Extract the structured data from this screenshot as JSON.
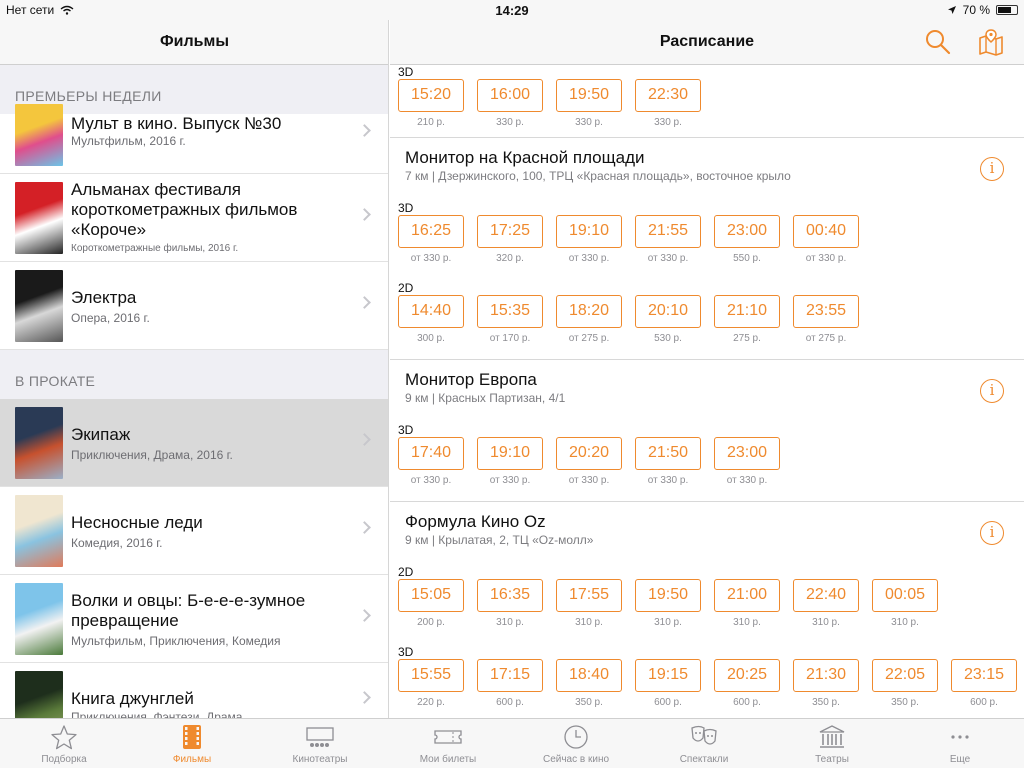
{
  "status": {
    "carrier": "Нет сети",
    "time": "14:29",
    "battery": "70 %",
    "battery_level": 0.7
  },
  "left": {
    "title": "Фильмы",
    "sections": [
      {
        "header": "ПРЕМЬЕРЫ НЕДЕЛИ",
        "movies": [
          {
            "title": "Мульт в кино. Выпуск №30",
            "meta": "Мультфильм, 2016 г.",
            "poster_colors": [
              "#f4c63d",
              "#e04e8c",
              "#6bc5e8"
            ]
          },
          {
            "title": "Альманах фестиваля короткометражных фильмов «Короче»",
            "meta": "Короткометражные фильмы, 2016 г.",
            "poster_colors": [
              "#d42026",
              "#ffffff",
              "#222222"
            ]
          },
          {
            "title": "Электра",
            "meta": "Опера, 2016 г.",
            "poster_colors": [
              "#1a1a1a",
              "#d8d8d8",
              "#555555"
            ]
          }
        ]
      },
      {
        "header": "В ПРОКАТЕ",
        "movies": [
          {
            "title": "Экипаж",
            "meta": "Приключения, Драма, 2016 г.",
            "poster_colors": [
              "#2a3a55",
              "#c7512e",
              "#9bb0c8"
            ],
            "selected": true
          },
          {
            "title": "Несносные леди",
            "meta": "Комедия, 2016 г.",
            "poster_colors": [
              "#f0e6d0",
              "#8ac3e0",
              "#e07a5a"
            ]
          },
          {
            "title": "Волки и овцы: Б-е-е-е-зумное превращение",
            "meta": "Мультфильм, Приключения, Комедия",
            "poster_colors": [
              "#7ec4ea",
              "#f2f2f2",
              "#4a7a3a"
            ]
          },
          {
            "title": "Книга джунглей",
            "meta": "Приключения, Фэнтези, Драма",
            "poster_colors": [
              "#1e2e1c",
              "#5a7a3a",
              "#a0b070"
            ]
          }
        ]
      }
    ]
  },
  "right": {
    "title": "Расписание",
    "cinemas": [
      {
        "name": "",
        "address": "",
        "partial": true,
        "groups": [
          {
            "format": "3D",
            "times": [
              {
                "time": "15:20",
                "price": "210 р."
              },
              {
                "time": "16:00",
                "price": "330 р."
              },
              {
                "time": "19:50",
                "price": "330 р."
              },
              {
                "time": "22:30",
                "price": "330 р."
              }
            ]
          }
        ]
      },
      {
        "name": "Монитор на Красной площади",
        "address": "7 км | Дзержинского, 100, ТРЦ «Красная площадь», восточное крыло",
        "groups": [
          {
            "format": "3D",
            "times": [
              {
                "time": "16:25",
                "price": "от 330 р."
              },
              {
                "time": "17:25",
                "price": "320 р."
              },
              {
                "time": "19:10",
                "price": "от 330 р."
              },
              {
                "time": "21:55",
                "price": "от 330 р."
              },
              {
                "time": "23:00",
                "price": "550 р."
              },
              {
                "time": "00:40",
                "price": "от 330 р."
              }
            ]
          },
          {
            "format": "2D",
            "times": [
              {
                "time": "14:40",
                "price": "300 р."
              },
              {
                "time": "15:35",
                "price": "от 170 р."
              },
              {
                "time": "18:20",
                "price": "от 275 р."
              },
              {
                "time": "20:10",
                "price": "530 р."
              },
              {
                "time": "21:10",
                "price": "275 р."
              },
              {
                "time": "23:55",
                "price": "от 275 р."
              }
            ]
          }
        ]
      },
      {
        "name": "Монитор Европа",
        "address": "9 км | Красных Партизан, 4/1",
        "groups": [
          {
            "format": "3D",
            "times": [
              {
                "time": "17:40",
                "price": "от 330 р."
              },
              {
                "time": "19:10",
                "price": "от 330 р."
              },
              {
                "time": "20:20",
                "price": "от 330 р."
              },
              {
                "time": "21:50",
                "price": "от 330 р."
              },
              {
                "time": "23:00",
                "price": "от 330 р."
              }
            ]
          }
        ]
      },
      {
        "name": "Формула Кино Oz",
        "address": "9 км | Крылатая, 2, ТЦ «Oz-молл»",
        "groups": [
          {
            "format": "2D",
            "times": [
              {
                "time": "15:05",
                "price": "200 р."
              },
              {
                "time": "16:35",
                "price": "310 р."
              },
              {
                "time": "17:55",
                "price": "310 р."
              },
              {
                "time": "19:50",
                "price": "310 р."
              },
              {
                "time": "21:00",
                "price": "310 р."
              },
              {
                "time": "22:40",
                "price": "310 р."
              },
              {
                "time": "00:05",
                "price": "310 р."
              }
            ]
          },
          {
            "format": "3D",
            "times": [
              {
                "time": "15:55",
                "price": "220 р."
              },
              {
                "time": "17:15",
                "price": "600 р."
              },
              {
                "time": "18:40",
                "price": "350 р."
              },
              {
                "time": "19:15",
                "price": "600 р."
              },
              {
                "time": "20:25",
                "price": "600 р."
              },
              {
                "time": "21:30",
                "price": "350 р."
              },
              {
                "time": "22:05",
                "price": "350 р."
              },
              {
                "time": "23:15",
                "price": "600 р."
              }
            ]
          }
        ]
      }
    ]
  },
  "tabs": [
    {
      "label": "Подборка",
      "icon": "star-icon"
    },
    {
      "label": "Фильмы",
      "icon": "film-icon",
      "active": true
    },
    {
      "label": "Кинотеатры",
      "icon": "cinema-screen-icon"
    },
    {
      "label": "Мои билеты",
      "icon": "ticket-icon"
    },
    {
      "label": "Сейчас в кино",
      "icon": "clock-icon"
    },
    {
      "label": "Спектакли",
      "icon": "theater-masks-icon"
    },
    {
      "label": "Театры",
      "icon": "theater-building-icon"
    },
    {
      "label": "Еще",
      "icon": "more-icon"
    }
  ],
  "colors": {
    "accent": "#ef8a2e",
    "selected_row": "#d9d9d9",
    "section_bg": "#efeff4"
  }
}
